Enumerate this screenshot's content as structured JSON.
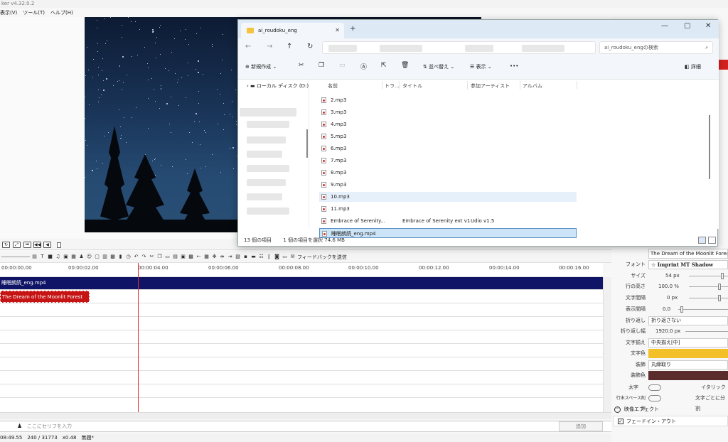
{
  "app": {
    "title": "ker v4.32.0.2",
    "menu": [
      "表示(V)",
      "ツール(T)",
      "ヘルプ(H)"
    ]
  },
  "timeline": {
    "ticks": [
      "00:00:00.00",
      "00:00:02.00",
      "00:00:04.00",
      "00:00:06.00",
      "00:00:08.00",
      "00:00:10.00",
      "00:00:12.00",
      "00:00:14.00",
      "00:00:16.00"
    ],
    "video_clip": "睡眠朗読_eng.mp4",
    "text_clip": "The Dream of the Moonlit Forest",
    "feedback_label": "フィードバックを送信"
  },
  "serif": {
    "placeholder": "ここにセリフを入力",
    "add_label": "追加"
  },
  "status": {
    "time": "08:49.55",
    "frames": "240 / 31773",
    "zoom": "x0.48",
    "project": "無題*"
  },
  "properties": {
    "text_value": "The Dream of the Moonlit Forest",
    "font_label": "フォント",
    "font_value": "Imprint MT Shadow",
    "size_label": "サイズ",
    "size_value": "54 px",
    "line_height_label": "行の高さ",
    "line_height_value": "100.0 %",
    "letter_spacing_label": "文字間隔",
    "letter_spacing_value": "0 px",
    "display_interval_label": "表示間隔",
    "display_interval_value": "0.0",
    "wrap_label": "折り返し",
    "wrap_value": "折り返さない",
    "wrap_width_label": "折り返し幅",
    "wrap_width_value": "1920.0 px",
    "align_label": "文字揃え",
    "align_value": "中央揃え[中]",
    "text_color_label": "文字色",
    "text_color": "#f3c02a",
    "outline_label": "装飾",
    "outline_value": "丸縁取り",
    "outline_color_label": "装飾色",
    "outline_color": "#5b2c2c",
    "bold_label": "太字",
    "italic_label": "イタリック",
    "trim_space_label": "行末スペース削除",
    "split_label": "文字ごとに分割",
    "effects_label": "映像エフェクト",
    "fade_label": "フェードイン・アウト"
  },
  "explorer": {
    "tab_title": "ai_roudoku_eng",
    "search_placeholder": "ai_roudoku_engの検索",
    "new_label": "新規作成",
    "sort_label": "並べ替え",
    "view_label": "表示",
    "more_label": "•••",
    "details_label": "詳細",
    "local_disk": "ローカル ディスク (D:)",
    "columns": [
      "名前",
      "トラ...",
      "タイトル",
      "参加アーティスト",
      "アルバム"
    ],
    "files": [
      {
        "name": "2.mp3",
        "title": "",
        "artist": ""
      },
      {
        "name": "3.mp3",
        "title": "",
        "artist": ""
      },
      {
        "name": "4.mp3",
        "title": "",
        "artist": ""
      },
      {
        "name": "5.mp3",
        "title": "",
        "artist": ""
      },
      {
        "name": "6.mp3",
        "title": "",
        "artist": ""
      },
      {
        "name": "7.mp3",
        "title": "",
        "artist": ""
      },
      {
        "name": "8.mp3",
        "title": "",
        "artist": ""
      },
      {
        "name": "9.mp3",
        "title": "",
        "artist": ""
      },
      {
        "name": "10.mp3",
        "title": "",
        "artist": ""
      },
      {
        "name": "11.mp3",
        "title": "",
        "artist": ""
      },
      {
        "name": "Embrace of Serenity...",
        "title": "Embrace of Serenity ext v1",
        "artist": "Udio v1.5"
      },
      {
        "name": "睡眠朗読_eng.mp4",
        "title": "",
        "artist": ""
      }
    ],
    "item_count": "13 個の項目",
    "selected": "1 個の項目を選択  74.6 MB"
  }
}
